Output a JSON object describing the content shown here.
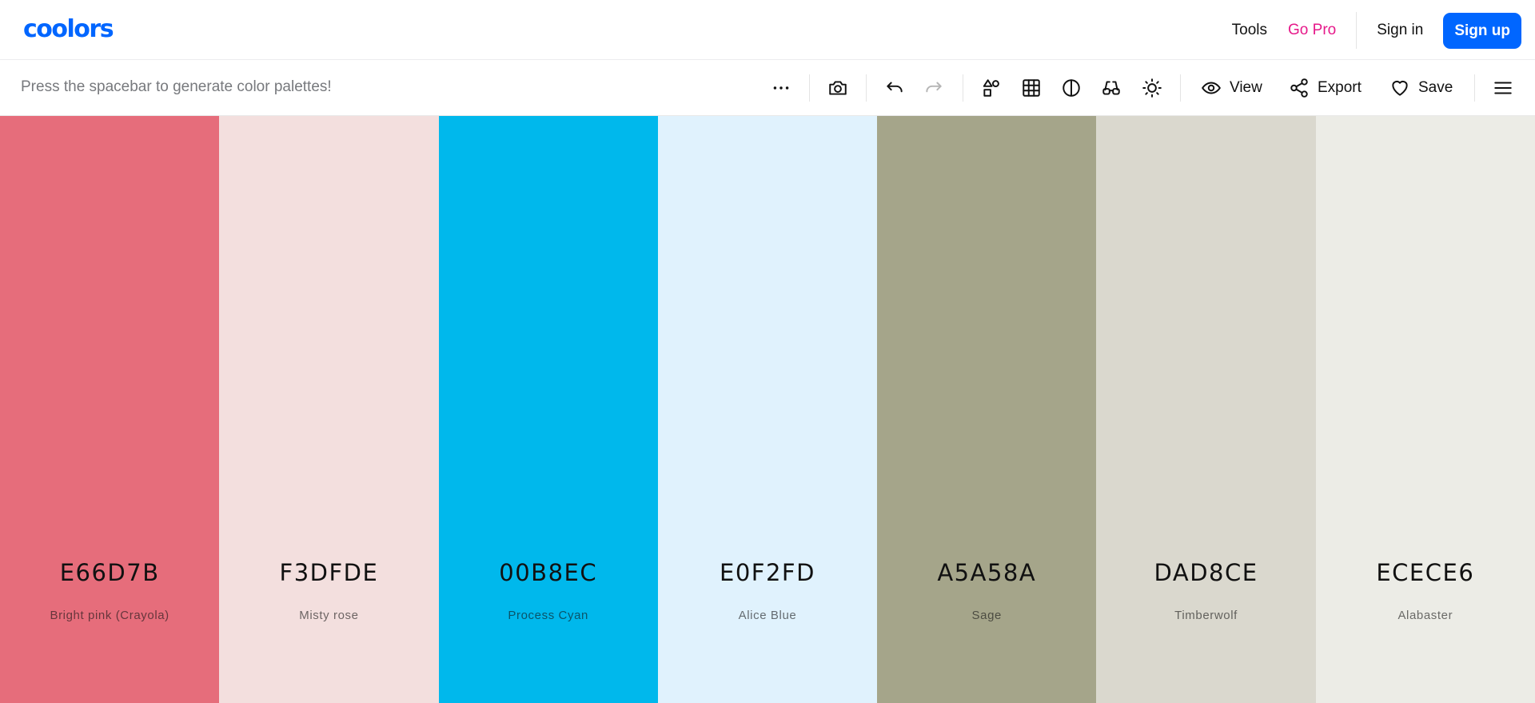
{
  "brand": {
    "logo": "coolors"
  },
  "nav": {
    "tools": "Tools",
    "go_pro": "Go Pro",
    "sign_in": "Sign in",
    "sign_up": "Sign up"
  },
  "toolbar": {
    "hint": "Press the spacebar to generate color palettes!",
    "view_label": "View",
    "export_label": "Export",
    "save_label": "Save",
    "icons": [
      "more-options-icon",
      "camera-icon",
      "undo-icon",
      "redo-icon",
      "shapes-icon",
      "grid-icon",
      "contrast-icon",
      "glasses-icon",
      "brightness-icon",
      "eye-icon",
      "share-icon",
      "heart-icon",
      "menu-icon"
    ]
  },
  "colors": {
    "accent": "#0066ff",
    "go_pro": "#e6198a"
  },
  "palette": [
    {
      "hex": "E66D7B",
      "name": "Bright pink (Crayola)",
      "color": "#E66D7B",
      "text_color": "#111111"
    },
    {
      "hex": "F3DFDE",
      "name": "Misty rose",
      "color": "#F3DFDE",
      "text_color": "#111111"
    },
    {
      "hex": "00B8EC",
      "name": "Process Cyan",
      "color": "#00B8EC",
      "text_color": "#111111"
    },
    {
      "hex": "E0F2FD",
      "name": "Alice Blue",
      "color": "#E0F2FD",
      "text_color": "#111111"
    },
    {
      "hex": "A5A58A",
      "name": "Sage",
      "color": "#A5A58A",
      "text_color": "#111111"
    },
    {
      "hex": "DAD8CE",
      "name": "Timberwolf",
      "color": "#DAD8CE",
      "text_color": "#111111"
    },
    {
      "hex": "ECECE6",
      "name": "Alabaster",
      "color": "#ECECE6",
      "text_color": "#111111"
    }
  ]
}
